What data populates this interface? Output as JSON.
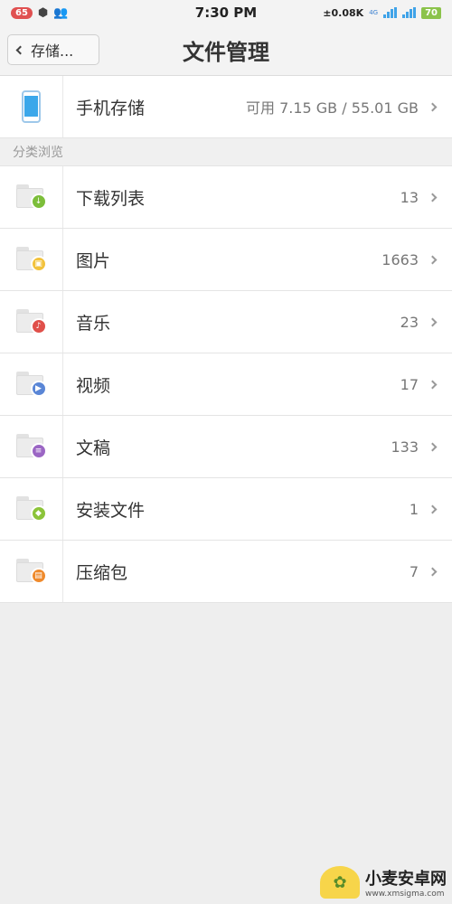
{
  "status_bar": {
    "notification_count": "65",
    "time": "7:30 PM",
    "net_speed": "±0.08K",
    "net_type": "4G",
    "battery": "70"
  },
  "header": {
    "back_label": "存储...",
    "title": "文件管理"
  },
  "storage": {
    "label": "手机存储",
    "value": "可用 7.15 GB / 55.01 GB"
  },
  "section": {
    "label": "分类浏览"
  },
  "categories": [
    {
      "label": "下载列表",
      "count": "13",
      "icon": "download-icon",
      "color": "#7cbe3a"
    },
    {
      "label": "图片",
      "count": "1663",
      "icon": "image-icon",
      "color": "#f2c23c"
    },
    {
      "label": "音乐",
      "count": "23",
      "icon": "music-icon",
      "color": "#e0504a"
    },
    {
      "label": "视频",
      "count": "17",
      "icon": "video-icon",
      "color": "#5a86d6"
    },
    {
      "label": "文稿",
      "count": "133",
      "icon": "document-icon",
      "color": "#9b66c4"
    },
    {
      "label": "安装文件",
      "count": "1",
      "icon": "android-icon",
      "color": "#8cc43a"
    },
    {
      "label": "压缩包",
      "count": "7",
      "icon": "archive-icon",
      "color": "#ef8a2c"
    }
  ],
  "watermark": {
    "name": "小麦安卓网",
    "url": "www.xmsigma.com"
  }
}
